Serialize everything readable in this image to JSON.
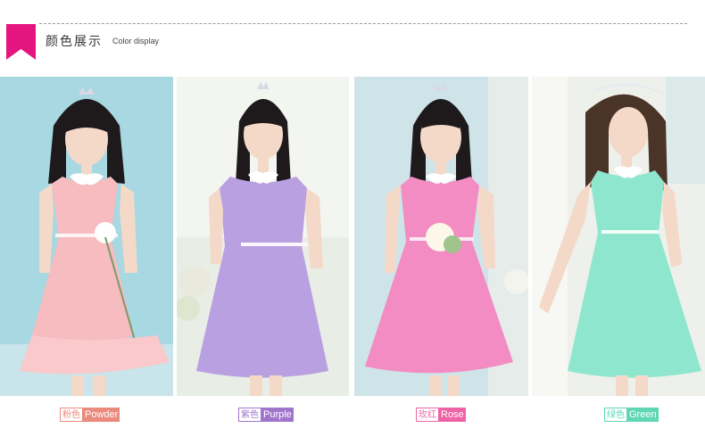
{
  "header": {
    "title_cn": "颜色展示",
    "title_en": "Color display",
    "accent_color": "#e4157f"
  },
  "photos": [
    {
      "name": "powder",
      "dress_color": "#f6bcc0",
      "bg_color": "#a8d8e2"
    },
    {
      "name": "purple",
      "dress_color": "#b9a0e0",
      "bg_color": "#e8eee6"
    },
    {
      "name": "rose",
      "dress_color": "#f28cc2",
      "bg_color": "#cfe4e8"
    },
    {
      "name": "green",
      "dress_color": "#8fe6cf",
      "bg_color": "#eef0ec"
    }
  ],
  "labels": [
    {
      "cn": "粉色",
      "en": "Powder",
      "color": "#ea8a7c"
    },
    {
      "cn": "紫色",
      "en": "Purple",
      "color": "#a075cc"
    },
    {
      "cn": "玫红",
      "en": "Rose",
      "color": "#ee63a6"
    },
    {
      "cn": "绿色",
      "en": "Green",
      "color": "#5fd7b3"
    }
  ]
}
